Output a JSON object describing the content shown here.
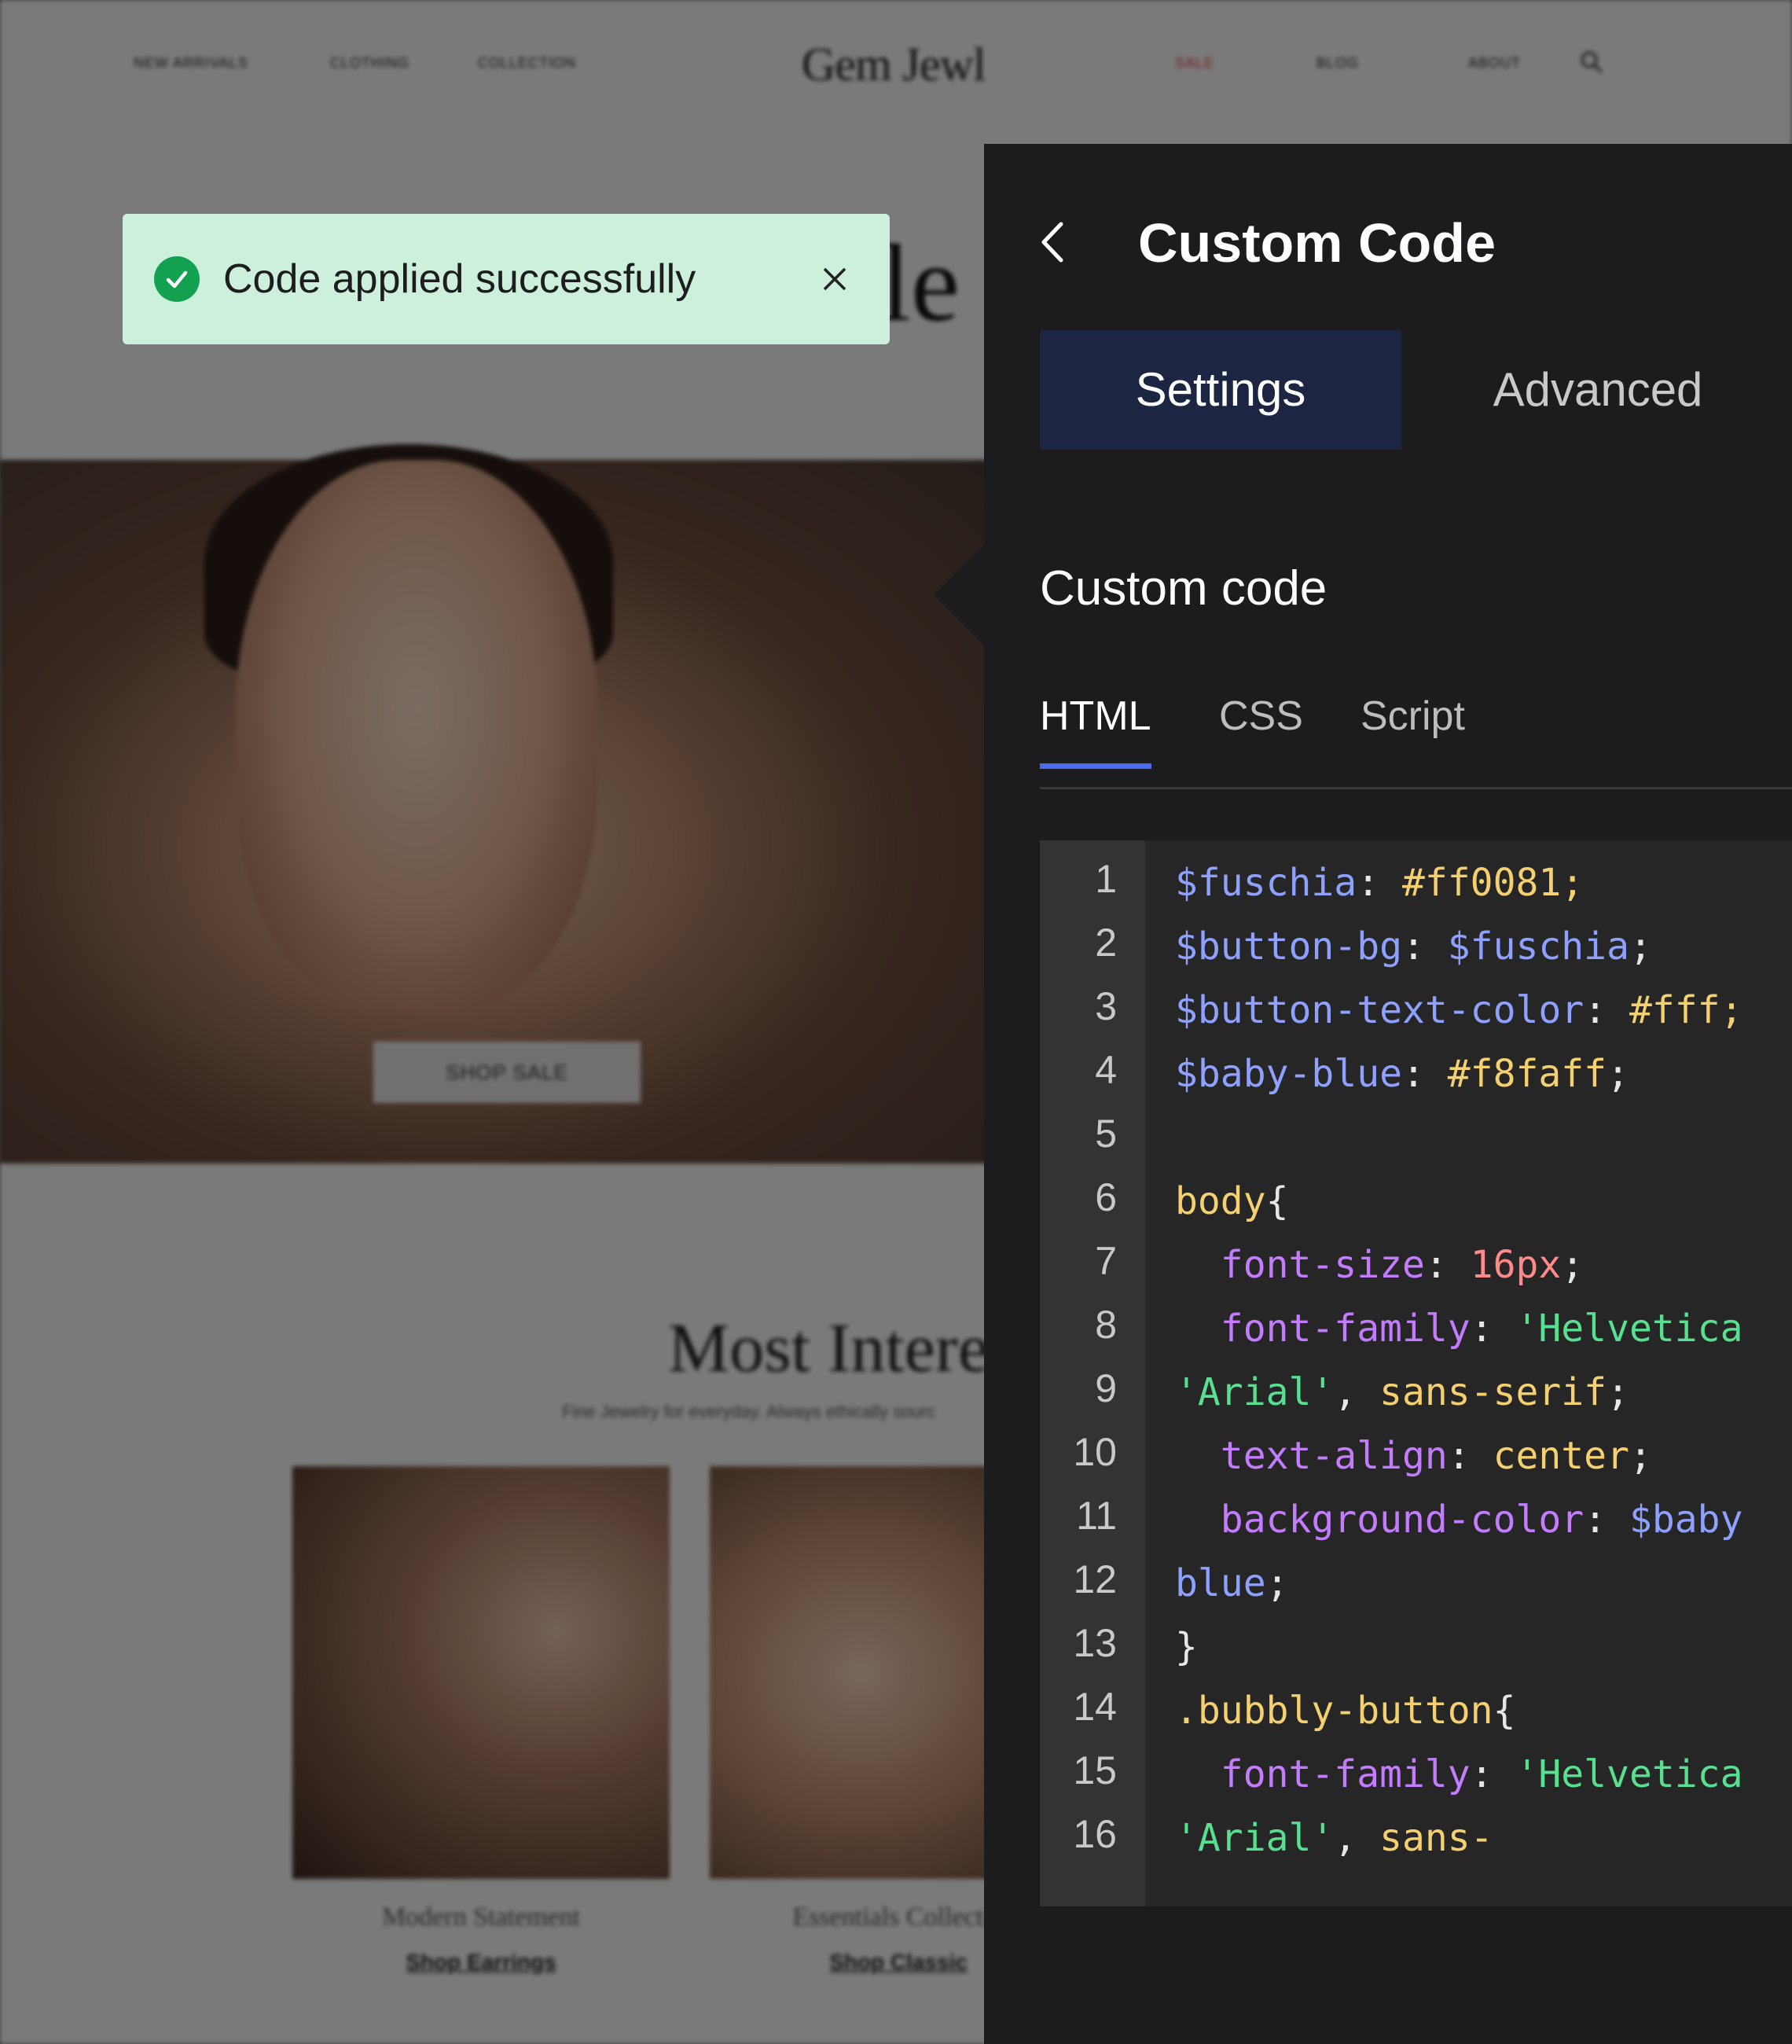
{
  "site": {
    "nav_left": [
      "NEW ARRIVALS",
      "CLOTHING",
      "COLLECTION"
    ],
    "logo": "Gem Jewl",
    "nav_right": [
      "SALE",
      "BLOG",
      "ABOUT"
    ],
    "hero_heading_partial": "le",
    "hero_button": "SHOP SALE",
    "section_title": "Most Intere",
    "section_subtitle": "Fine Jewelry for everyday. Always ethically sourc",
    "products": [
      {
        "name": "Modern Statement",
        "link": "Shop Earrings"
      },
      {
        "name": "Essentials Collectio",
        "link": "Shop Classic"
      }
    ]
  },
  "toast": {
    "message": "Code applied successfully"
  },
  "panel": {
    "title": "Custom Code",
    "tabs": [
      "Settings",
      "Advanced"
    ],
    "active_tab": "Settings",
    "section_label": "Custom code",
    "code_tabs": [
      "HTML",
      "CSS",
      "Script"
    ],
    "active_code_tab": "HTML"
  },
  "editor": {
    "line_numbers": [
      "1",
      "2",
      "3",
      "4",
      "5",
      "6",
      "7",
      "8",
      "9",
      "10",
      "11",
      "12",
      "13",
      "14",
      "15",
      "16"
    ],
    "lines": [
      [
        {
          "t": "var",
          "v": "$fuschia"
        },
        {
          "t": "punct",
          "v": ": "
        },
        {
          "t": "val",
          "v": "#ff0081;"
        }
      ],
      [
        {
          "t": "var",
          "v": "$button-bg"
        },
        {
          "t": "punct",
          "v": ": "
        },
        {
          "t": "var",
          "v": "$fuschia"
        },
        {
          "t": "punct",
          "v": ";"
        }
      ],
      [
        {
          "t": "var",
          "v": "$button-text-color"
        },
        {
          "t": "punct",
          "v": ": "
        },
        {
          "t": "val",
          "v": "#fff;"
        }
      ],
      [
        {
          "t": "var",
          "v": "$baby-blue"
        },
        {
          "t": "punct",
          "v": ": "
        },
        {
          "t": "val",
          "v": "#f8faff"
        },
        {
          "t": "punct",
          "v": ";"
        }
      ],
      [],
      [
        {
          "t": "sel",
          "v": "body"
        },
        {
          "t": "punct",
          "v": "{"
        }
      ],
      [
        {
          "t": "punct",
          "v": "  "
        },
        {
          "t": "prop",
          "v": "font-size"
        },
        {
          "t": "punct",
          "v": ": "
        },
        {
          "t": "num",
          "v": "16px"
        },
        {
          "t": "punct",
          "v": ";"
        }
      ],
      [
        {
          "t": "punct",
          "v": "  "
        },
        {
          "t": "prop",
          "v": "font-family"
        },
        {
          "t": "punct",
          "v": ": "
        },
        {
          "t": "str",
          "v": "'Helvetica"
        }
      ],
      [
        {
          "t": "str",
          "v": "'Arial'"
        },
        {
          "t": "punct",
          "v": ", "
        },
        {
          "t": "val",
          "v": "sans-serif"
        },
        {
          "t": "punct",
          "v": ";"
        }
      ],
      [
        {
          "t": "punct",
          "v": "  "
        },
        {
          "t": "prop",
          "v": "text-align"
        },
        {
          "t": "punct",
          "v": ": "
        },
        {
          "t": "val",
          "v": "center"
        },
        {
          "t": "punct",
          "v": ";"
        }
      ],
      [
        {
          "t": "punct",
          "v": "  "
        },
        {
          "t": "prop",
          "v": "background-color"
        },
        {
          "t": "punct",
          "v": ": "
        },
        {
          "t": "var",
          "v": "$baby"
        }
      ],
      [
        {
          "t": "var",
          "v": "blue"
        },
        {
          "t": "punct",
          "v": ";"
        }
      ],
      [
        {
          "t": "punct",
          "v": "}"
        }
      ],
      [
        {
          "t": "val",
          "v": ".bubbly-button"
        },
        {
          "t": "punct",
          "v": "{"
        }
      ],
      [
        {
          "t": "punct",
          "v": "  "
        },
        {
          "t": "prop",
          "v": "font-family"
        },
        {
          "t": "punct",
          "v": ": "
        },
        {
          "t": "str",
          "v": "'Helvetica"
        }
      ],
      [
        {
          "t": "str",
          "v": "'Arial'"
        },
        {
          "t": "punct",
          "v": ", "
        },
        {
          "t": "val",
          "v": "sans-"
        }
      ]
    ]
  },
  "colors": {
    "panel_bg": "#1c1c1e",
    "active_tab_bg": "#1c2541",
    "tab_underline": "#4b6bef",
    "toast_bg": "#ccf0dc",
    "toast_check": "#12a150"
  }
}
